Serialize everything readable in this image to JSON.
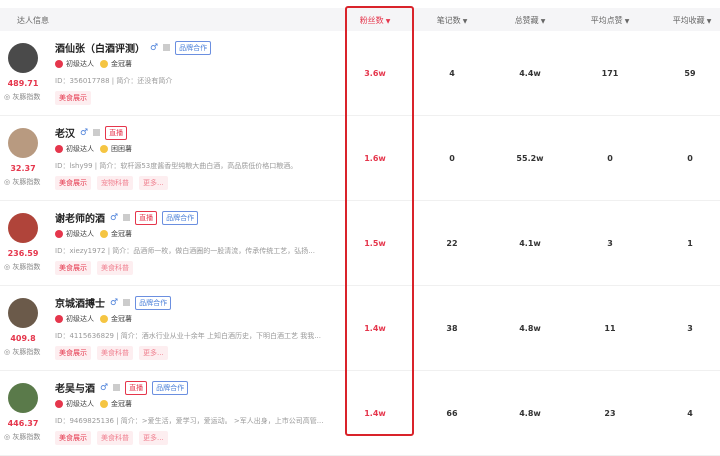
{
  "headers": {
    "info": "达人信息",
    "fans": "粉丝数",
    "notes": "笔记数",
    "likes": "总赞藏",
    "avg_like": "平均点赞",
    "avg_fav": "平均收藏"
  },
  "rows": [
    {
      "name": "酒仙张（白酒评测）",
      "live": "",
      "brand": "品牌合作",
      "level": "初级达人",
      "badge": "金冠薯",
      "bio": "ID：356017788 | 简介：还没有简介",
      "tags": [
        "美食展示"
      ],
      "score": "489.71",
      "index_label": "灰豚指数",
      "fans": "3.6w",
      "notes": "4",
      "likes": "4.4w",
      "avg_like": "171",
      "avg_fav": "59",
      "avatar_color": "#4a4a4a"
    },
    {
      "name": "老汉",
      "live": "直播",
      "brand": "",
      "level": "初级达人",
      "badge": "困困薯",
      "bio": "ID：lshy99 | 简介：软杆源53度酱香型纯粮大曲白酒，高品质低价格口粮酒。",
      "tags": [
        "美食展示",
        "宠物科普",
        "更多..."
      ],
      "score": "32.37",
      "index_label": "灰豚指数",
      "fans": "1.6w",
      "notes": "0",
      "likes": "55.2w",
      "avg_like": "0",
      "avg_fav": "0",
      "avatar_color": "#b89a80"
    },
    {
      "name": "谢老师的酒",
      "live": "直播",
      "brand": "品牌合作",
      "level": "初级达人",
      "badge": "金冠薯",
      "bio": "ID：xiezy1972 | 简介：品酒师一枚，做白酒圈的一股清流，传承传统工艺，弘扬...",
      "tags": [
        "美食展示",
        "美食科普"
      ],
      "score": "236.59",
      "index_label": "灰豚指数",
      "fans": "1.5w",
      "notes": "22",
      "likes": "4.1w",
      "avg_like": "3",
      "avg_fav": "1",
      "avatar_color": "#b0443a"
    },
    {
      "name": "京城酒搏士",
      "live": "",
      "brand": "品牌合作",
      "level": "初级达人",
      "badge": "金冠薯",
      "bio": "ID：4115636829 | 简介：酒水行业从业十余年 上知白酒历史，下明白酒工艺 我我...",
      "tags": [
        "美食展示",
        "美食科普",
        "更多..."
      ],
      "score": "409.8",
      "index_label": "灰豚指数",
      "fans": "1.4w",
      "notes": "38",
      "likes": "4.8w",
      "avg_like": "11",
      "avg_fav": "3",
      "avatar_color": "#6b5a4a"
    },
    {
      "name": "老吴与酒",
      "live": "直播",
      "brand": "品牌合作",
      "level": "初级达人",
      "badge": "金冠薯",
      "bio": "ID：9469825136 | 简介：>爱生活，爱学习，爱运动。 >军人出身，上市公司高管...",
      "tags": [
        "美食展示",
        "美食科普",
        "更多..."
      ],
      "score": "446.37",
      "index_label": "灰豚指数",
      "fans": "1.4w",
      "notes": "66",
      "likes": "4.8w",
      "avg_like": "23",
      "avg_fav": "4",
      "avatar_color": "#5a7a4a"
    }
  ]
}
